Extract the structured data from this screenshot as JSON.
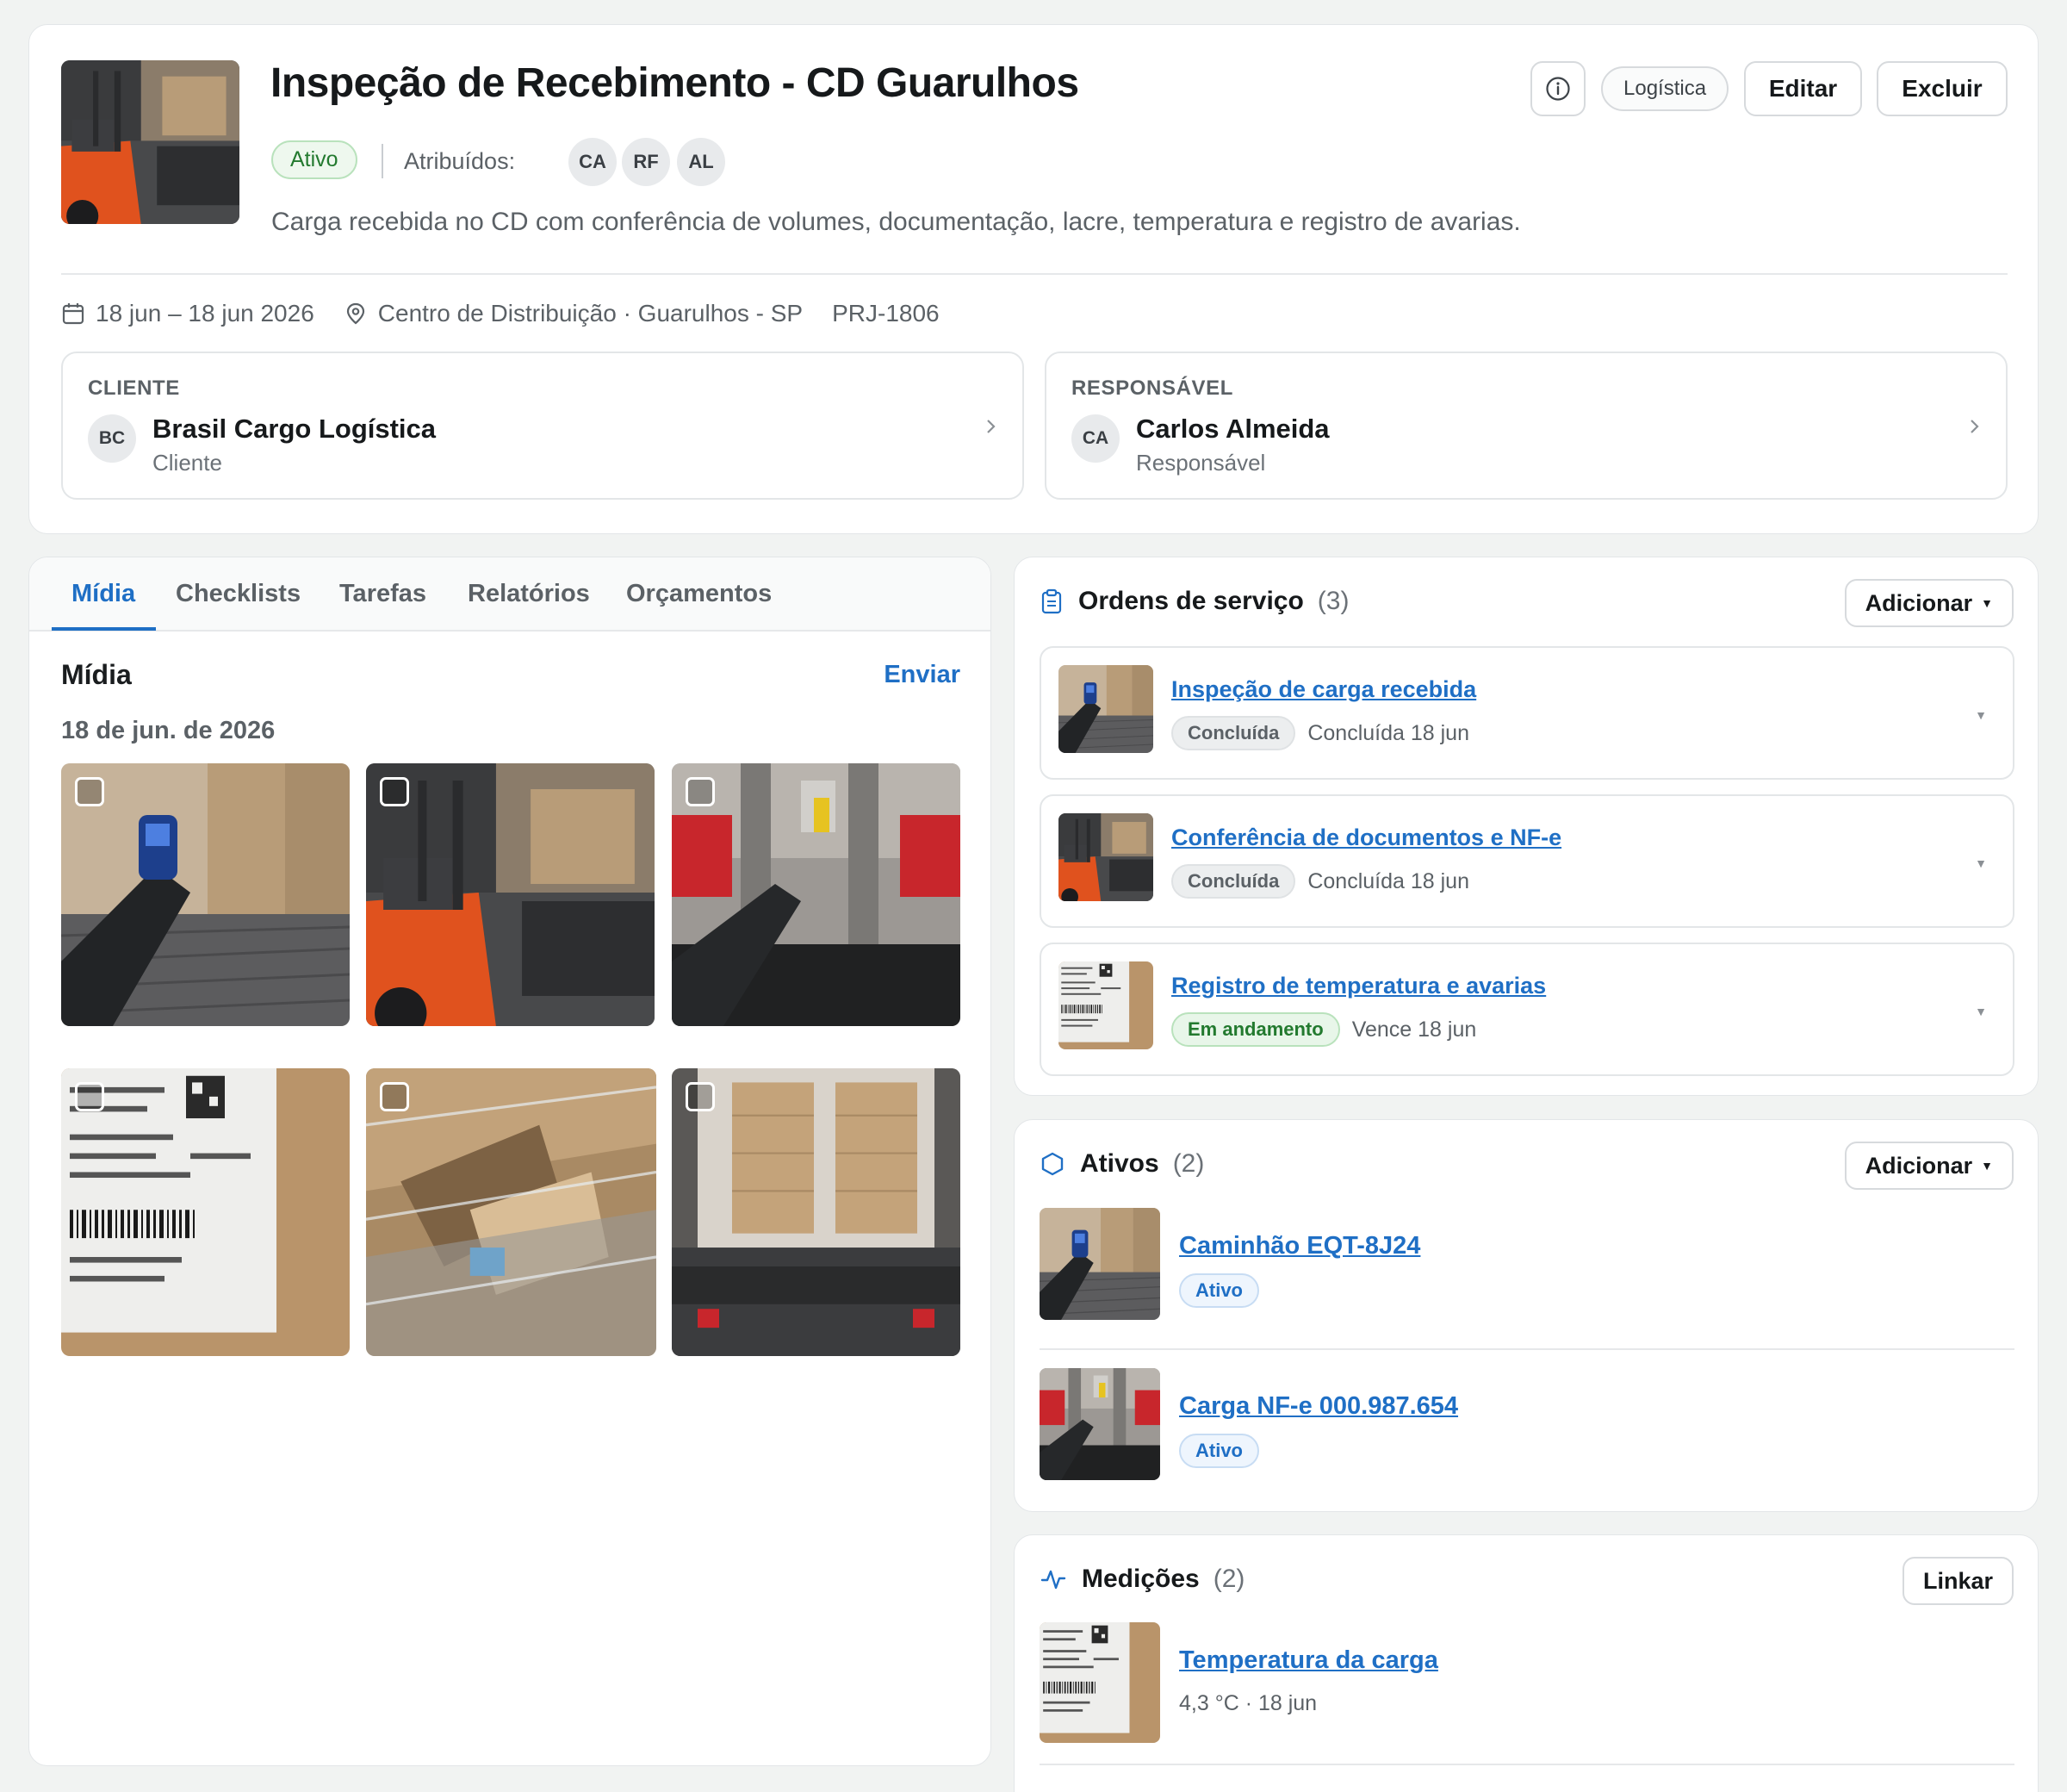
{
  "header": {
    "title": "Inspeção de Recebimento - CD Guarulhos",
    "status": "Ativo",
    "assigned_label": "Atribuídos:",
    "assignees": [
      "CA",
      "RF",
      "AL"
    ],
    "description": "Carga recebida no CD com conferência de volumes, documentação, lacre, temperatura e registro de avarias.",
    "tag": "Logística",
    "edit_label": "Editar",
    "delete_label": "Excluir",
    "dates": "18 jun – 18 jun 2026",
    "location": "Centro de Distribuição · Guarulhos - SP",
    "project_code": "PRJ-1806"
  },
  "client": {
    "kicker": "CLIENTE",
    "initials": "BC",
    "name": "Brasil Cargo Logística",
    "role": "Cliente"
  },
  "responsible": {
    "kicker": "RESPONSÁVEL",
    "initials": "CA",
    "name": "Carlos Almeida",
    "role": "Responsável"
  },
  "tabs": [
    "Mídia",
    "Checklists",
    "Tarefas",
    "Relatórios",
    "Orçamentos"
  ],
  "media": {
    "title": "Mídia",
    "send_label": "Enviar",
    "date_group": "18 de jun. de 2026"
  },
  "service_orders": {
    "title": "Ordens de serviço",
    "count": "(3)",
    "add_label": "Adicionar",
    "items": [
      {
        "title": "Inspeção de carga recebida",
        "status": "Concluída",
        "date": "Concluída 18 jun"
      },
      {
        "title": "Conferência de documentos e NF-e",
        "status": "Concluída",
        "date": "Concluída 18 jun"
      },
      {
        "title": "Registro de temperatura e avarias",
        "status": "Em andamento",
        "date": "Vence 18 jun"
      }
    ]
  },
  "assets": {
    "title": "Ativos",
    "count": "(2)",
    "add_label": "Adicionar",
    "items": [
      {
        "name": "Caminhão EQT-8J24",
        "status": "Ativo"
      },
      {
        "name": "Carga NF-e 000.987.654",
        "status": "Ativo"
      }
    ]
  },
  "measurements": {
    "title": "Medições",
    "count": "(2)",
    "link_label": "Linkar",
    "items": [
      {
        "name": "Temperatura da carga",
        "detail": "4,3 °C · 18 jun"
      }
    ]
  },
  "colors": {
    "accent": "#1f6fc5",
    "success": "#237a2f",
    "background": "#f1f3f2"
  },
  "icons": [
    "info-icon",
    "calendar-icon",
    "map-pin-icon",
    "chevron-right-icon",
    "clipboard-icon",
    "hexagon-icon",
    "activity-icon",
    "caret-down-icon"
  ]
}
